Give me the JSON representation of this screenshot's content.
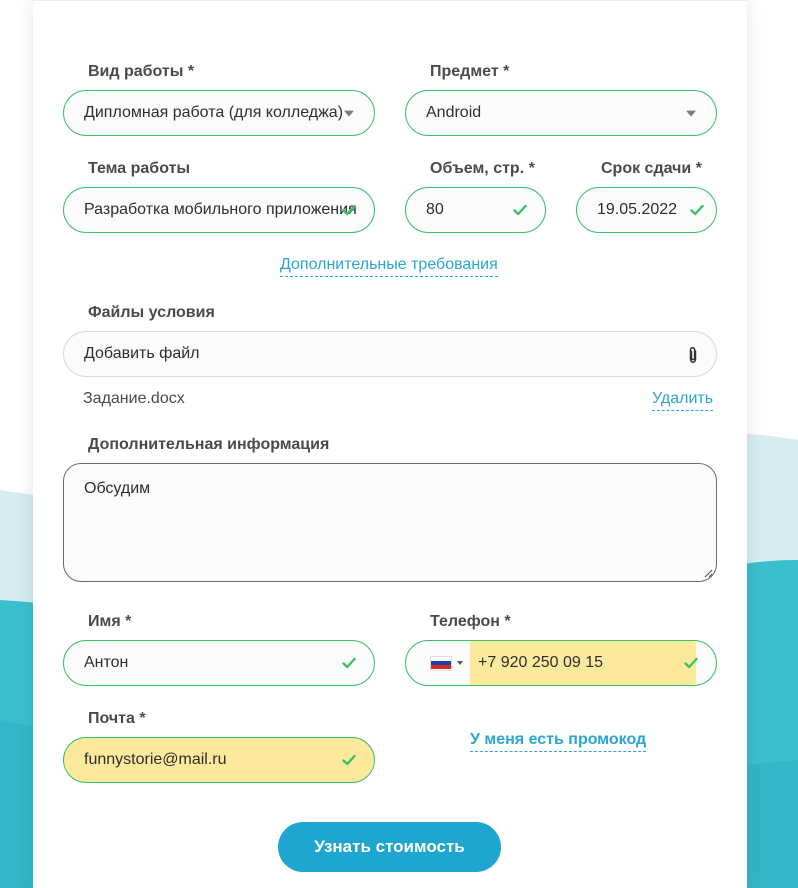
{
  "form": {
    "work_type": {
      "label": "Вид работы *",
      "value": "Дипломная работа (для колледжа)"
    },
    "subject": {
      "label": "Предмет *",
      "value": "Android"
    },
    "topic": {
      "label": "Тема работы",
      "value": "Разработка мобильного приложения"
    },
    "pages": {
      "label": "Объем, стр. *",
      "value": "80"
    },
    "deadline": {
      "label": "Срок сдачи *",
      "value": "19.05.2022"
    },
    "extra_requirements_link": "Дополнительные требования",
    "files": {
      "label": "Файлы условия",
      "placeholder": "Добавить файл",
      "attached_file": "Задание.docx",
      "delete_link": "Удалить"
    },
    "additional_info": {
      "label": "Дополнительная информация",
      "value": "Обсудим"
    },
    "name": {
      "label": "Имя *",
      "value": "Антон"
    },
    "phone": {
      "label": "Телефон *",
      "value": "+7 920 250 09 15",
      "country": "ru"
    },
    "email": {
      "label": "Почта *",
      "value": "funnystorie@mail.ru"
    },
    "promo_link": "У меня есть промокод",
    "submit_label": "Узнать стоимость"
  },
  "colors": {
    "accent": "#1ea6d1",
    "valid_border": "#3cc06a",
    "autofill": "#fce99b",
    "link": "#2aa6d3",
    "wave_light": "#d6ecf0",
    "wave_dark": "#3bbfcf"
  },
  "icons": {
    "check": "check-icon",
    "dropdown": "chevron-down-icon",
    "attach": "paperclip-icon",
    "flag": "russia-flag-icon"
  }
}
